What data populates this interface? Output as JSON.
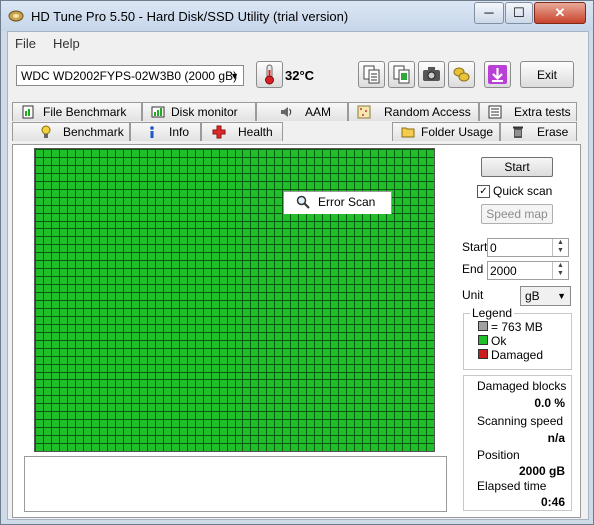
{
  "window": {
    "title": "HD Tune Pro 5.50 - Hard Disk/SSD Utility (trial version)",
    "controls": {
      "minimize": "─",
      "maximize": "☐",
      "close": "✕"
    }
  },
  "menu": {
    "file": "File",
    "help": "Help"
  },
  "toolbar": {
    "drive": "WDC WD2002FYPS-02W3B0 (2000 gB)",
    "temperature": "32°C",
    "exit_label": "Exit",
    "icons": [
      "copy-text-icon",
      "copy-image-icon",
      "camera-icon",
      "coins-icon",
      "download-arrow-icon"
    ]
  },
  "tabs": {
    "row1": [
      {
        "label": "File Benchmark",
        "icon": "file-benchmark-icon"
      },
      {
        "label": "Disk monitor",
        "icon": "disk-monitor-icon"
      },
      {
        "label": "AAM",
        "icon": "speaker-icon"
      },
      {
        "label": "Random Access",
        "icon": "random-access-icon"
      },
      {
        "label": "Extra tests",
        "icon": "extra-tests-icon"
      }
    ],
    "row2": [
      {
        "label": "Benchmark",
        "icon": "benchmark-icon"
      },
      {
        "label": "Info",
        "icon": "info-icon"
      },
      {
        "label": "Health",
        "icon": "health-cross-icon"
      },
      {
        "label": "Error Scan",
        "icon": "magnifier-icon"
      },
      {
        "label": "Folder Usage",
        "icon": "folder-icon"
      },
      {
        "label": "Erase",
        "icon": "trash-icon"
      }
    ],
    "active": "Error Scan"
  },
  "scan": {
    "start_label": "Start",
    "quick_scan_label": "Quick scan",
    "quick_scan_checked": true,
    "speed_map_label": "Speed map",
    "start_field_label": "Start",
    "start_value": "0",
    "end_field_label": "End",
    "end_value": "2000",
    "unit_label": "Unit",
    "unit_value": "gB"
  },
  "legend": {
    "title": "Legend",
    "items": [
      {
        "label": "= 763 MB",
        "color": "#a0a0a0"
      },
      {
        "label": "Ok",
        "color": "#1fbf2a"
      },
      {
        "label": "Damaged",
        "color": "#cc1d1d"
      }
    ]
  },
  "stats": {
    "damaged_blocks_label": "Damaged blocks",
    "damaged_blocks_value": "0.0 %",
    "scanning_speed_label": "Scanning speed",
    "scanning_speed_value": "n/a",
    "position_label": "Position",
    "position_value": "2000 gB",
    "elapsed_label": "Elapsed time",
    "elapsed_value": "0:46"
  },
  "colors": {
    "block_ok": "#1fbf2a",
    "block_grid_line": "#0b5a10"
  }
}
